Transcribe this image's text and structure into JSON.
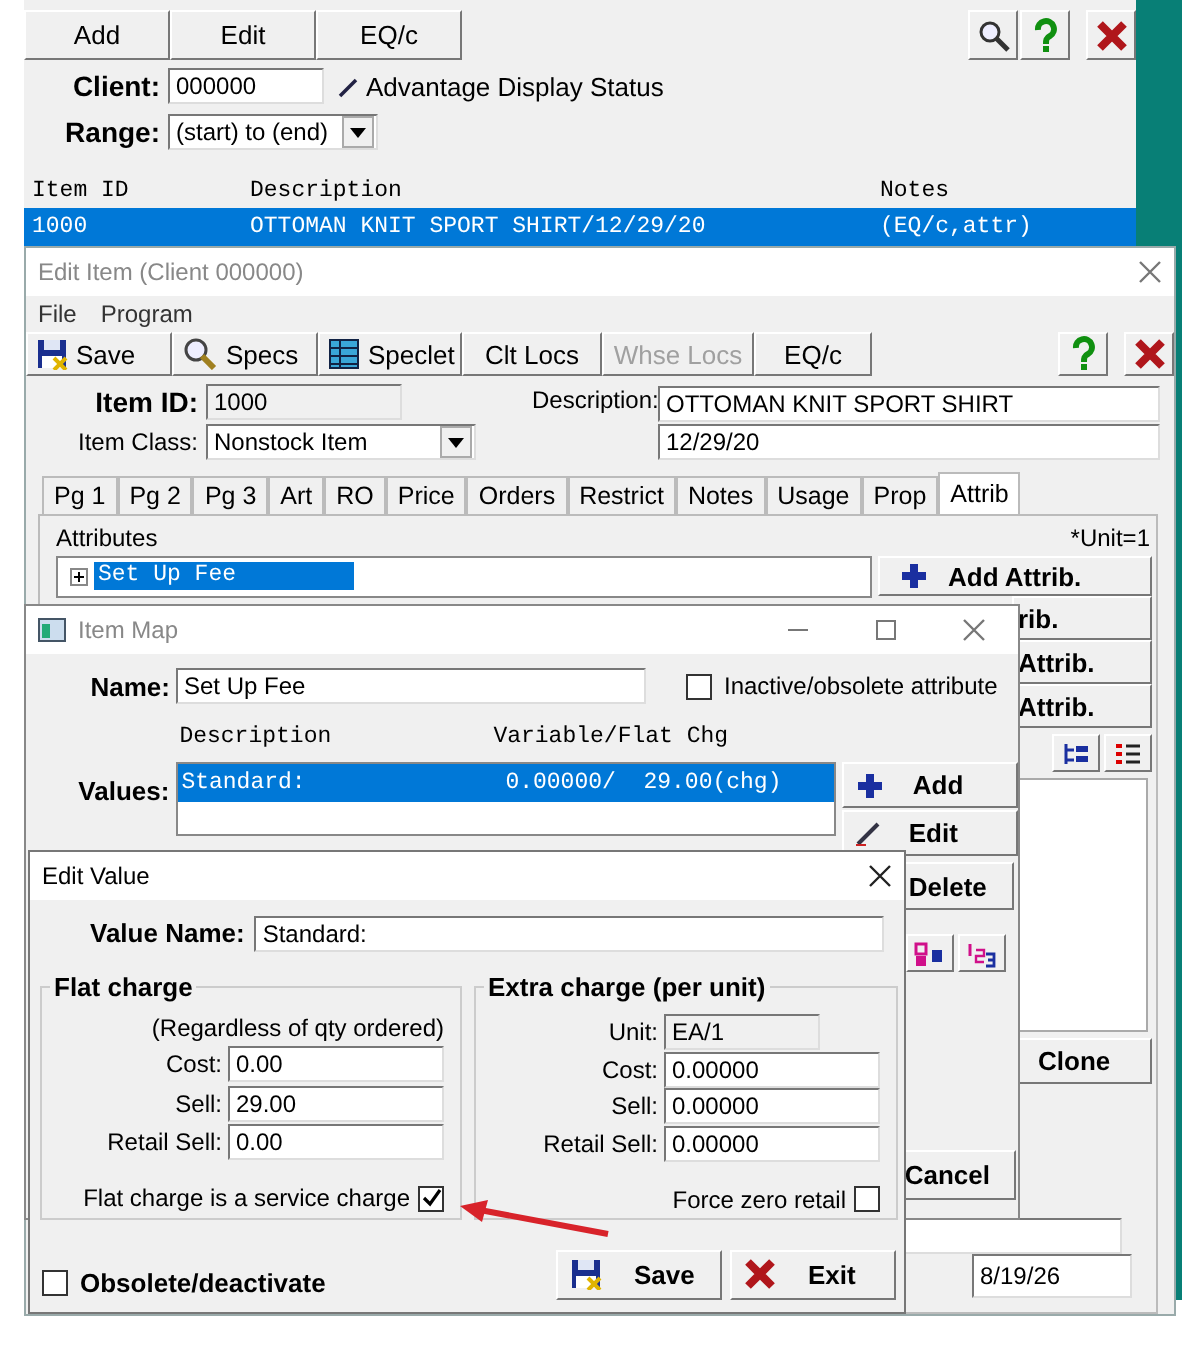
{
  "main_window": {
    "toolbar": [
      {
        "label": "Add"
      },
      {
        "label": "Edit"
      },
      {
        "label": "EQ/c"
      }
    ],
    "client": {
      "label": "Client:",
      "value": "000000"
    },
    "status_link": "Advantage Display Status",
    "range": {
      "label": "Range:",
      "value": "(start) to (end)"
    },
    "columns": [
      "Item ID",
      "Description",
      "Notes"
    ],
    "rows": [
      {
        "cells": [
          "1000",
          "OTTOMAN KNIT SPORT SHIRT/12/29/20",
          "(EQ/c,attr)"
        ],
        "selected": true
      }
    ]
  },
  "edit_item": {
    "title": "Edit Item (Client 000000)",
    "menu": [
      "File",
      "Program"
    ],
    "toolbar": [
      {
        "label": "Save",
        "kind": "save",
        "disabled": false
      },
      {
        "label": "Specs",
        "kind": "specs",
        "disabled": false
      },
      {
        "label": "Speclet",
        "kind": "speclet",
        "disabled": false
      },
      {
        "label": "Clt Locs",
        "kind": "text",
        "disabled": false
      },
      {
        "label": "Whse Locs",
        "kind": "text",
        "disabled": true
      },
      {
        "label": "EQ/c",
        "kind": "text",
        "disabled": false
      }
    ],
    "item_id": {
      "label": "Item ID:",
      "value": "1000"
    },
    "item_class": {
      "label": "Item Class:",
      "value": "Nonstock Item"
    },
    "description": {
      "label": "Description:",
      "lines": [
        "OTTOMAN KNIT SPORT SHIRT",
        "12/29/20"
      ]
    },
    "tabs": [
      {
        "label": "Pg 1",
        "selected": false
      },
      {
        "label": "Pg 2",
        "selected": false
      },
      {
        "label": "Pg 3",
        "selected": false
      },
      {
        "label": "Art",
        "selected": false
      },
      {
        "label": "RO",
        "selected": false
      },
      {
        "label": "Price",
        "selected": false
      },
      {
        "label": "Orders",
        "selected": false
      },
      {
        "label": "Restrict",
        "selected": false
      },
      {
        "label": "Notes",
        "selected": false
      },
      {
        "label": "Usage",
        "selected": false
      },
      {
        "label": "Prop",
        "selected": false
      },
      {
        "label": "Attrib",
        "selected": true
      }
    ],
    "attributes_label": "Attributes",
    "unit_note": "*Unit=1",
    "tree": [
      {
        "label": "Set Up Fee",
        "expanded": false,
        "selected": true
      }
    ],
    "side_buttons": [
      {
        "label": "Add Attrib.",
        "kind": "add"
      },
      {
        "label": "rib.",
        "kind": "text"
      },
      {
        "label": "Attrib.",
        "kind": "text"
      },
      {
        "label": "Attrib.",
        "kind": "text"
      }
    ],
    "clone_button": "Clone",
    "date": "8/19/26"
  },
  "item_map": {
    "title": "Item Map",
    "name": {
      "label": "Name:",
      "value": "Set Up Fee"
    },
    "inactive": {
      "label": "Inactive/obsolete attribute",
      "checked": false
    },
    "columns": [
      "Description",
      "Variable/Flat Chg"
    ],
    "values_label": "Values:",
    "rows": [
      {
        "description": "Standard:",
        "charge": "0.00000/  29.00(chg)",
        "selected": true
      }
    ],
    "buttons": [
      {
        "label": "Add",
        "kind": "add"
      },
      {
        "label": "Edit",
        "kind": "edit"
      },
      {
        "label": "Delete",
        "kind": "text"
      }
    ],
    "cancel_button": "Cancel"
  },
  "edit_value": {
    "title": "Edit Value",
    "value_name": {
      "label": "Value Name:",
      "value": "Standard:"
    },
    "flat": {
      "title": "Flat charge",
      "note": "(Regardless of qty ordered)",
      "fields": [
        {
          "label": "Cost:",
          "value": "0.00"
        },
        {
          "label": "Sell:",
          "value": "29.00"
        },
        {
          "label": "Retail Sell:",
          "value": "0.00"
        }
      ],
      "service": {
        "label": "Flat charge is a service charge",
        "checked": true
      }
    },
    "extra": {
      "title": "Extra charge (per unit)",
      "unit": {
        "label": "Unit:",
        "value": "EA/1"
      },
      "fields": [
        {
          "label": "Cost:",
          "value": "0.00000"
        },
        {
          "label": "Sell:",
          "value": "0.00000"
        },
        {
          "label": "Retail Sell:",
          "value": "0.00000"
        }
      ],
      "force_zero": {
        "label": "Force zero retail",
        "checked": false
      }
    },
    "obsolete": {
      "label": "Obsolete/deactivate",
      "checked": false
    },
    "buttons": [
      {
        "label": "Save",
        "kind": "save"
      },
      {
        "label": "Exit",
        "kind": "exit"
      }
    ]
  }
}
